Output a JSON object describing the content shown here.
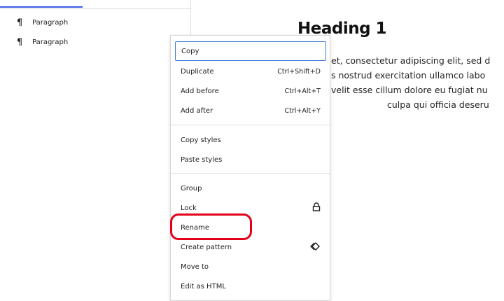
{
  "list_view": {
    "items": [
      {
        "label": "Paragraph",
        "icon": "paragraph-icon"
      },
      {
        "label": "Paragraph",
        "icon": "paragraph-icon"
      }
    ]
  },
  "editor": {
    "heading": "Heading 1",
    "paragraph_lines": [
      "et, consectetur adipiscing elit, sed d",
      "s nostrud exercitation ullamco labo",
      "velit esse cillum dolore eu fugiat nu",
      "culpa qui officia deseru"
    ]
  },
  "context_menu": {
    "copy": "Copy",
    "duplicate": {
      "label": "Duplicate",
      "shortcut": "Ctrl+Shift+D"
    },
    "add_before": {
      "label": "Add before",
      "shortcut": "Ctrl+Alt+T"
    },
    "add_after": {
      "label": "Add after",
      "shortcut": "Ctrl+Alt+Y"
    },
    "copy_styles": "Copy styles",
    "paste_styles": "Paste styles",
    "group": "Group",
    "lock": {
      "label": "Lock",
      "icon": "lock-icon"
    },
    "rename": "Rename",
    "create_pattern": {
      "label": "Create pattern",
      "icon": "pattern-diamond-icon"
    },
    "move_to": "Move to",
    "edit_as_html": "Edit as HTML"
  },
  "colors": {
    "accent": "#3858e9",
    "focus_outline": "#3d7bd9",
    "annotation_red": "#e3001b"
  }
}
